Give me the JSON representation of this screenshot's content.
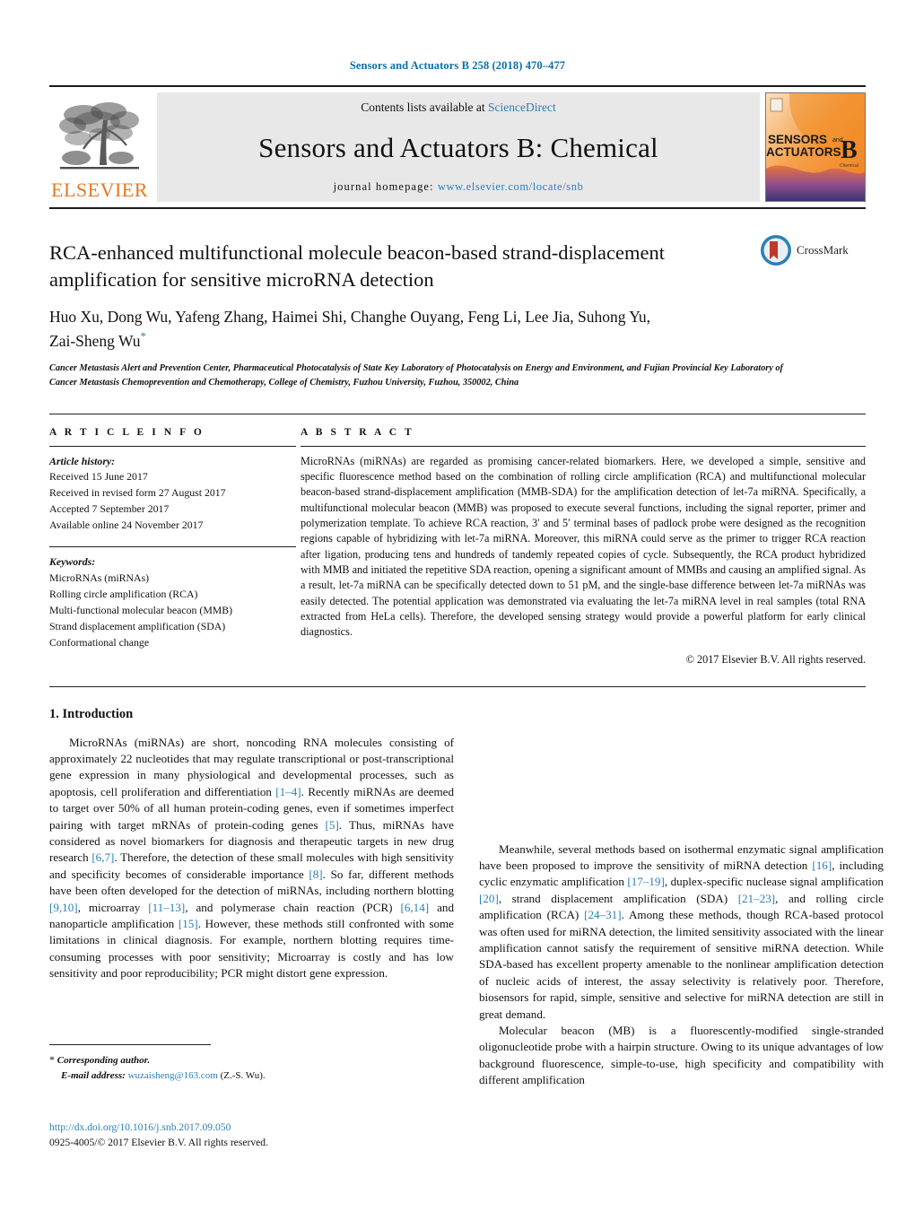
{
  "running_head": "Sensors and Actuators B 258 (2018) 470–477",
  "masthead": {
    "publisher_logo_word": "ELSEVIER",
    "contents_prefix": "Contents lists available at ",
    "contents_link": "ScienceDirect",
    "journal_title": "Sensors and Actuators B: Chemical",
    "homepage_prefix": "journal homepage: ",
    "homepage_url": "www.elsevier.com/locate/snb",
    "cover": {
      "line1": "SENSORS",
      "line1_suffix": "and",
      "line2": "ACTUATORS",
      "letter": "B",
      "letter_sub": "Chemical"
    }
  },
  "crossmark": {
    "label": "CrossMark"
  },
  "article": {
    "title": "RCA-enhanced multifunctional molecule beacon-based strand-displacement amplification for sensitive microRNA detection",
    "authors": "Huo Xu, Dong Wu, Yafeng Zhang, Haimei Shi, Changhe Ouyang, Feng Li, Lee Jia, Suhong Yu, Zai-Sheng Wu",
    "corresponding_marker": "*",
    "affiliation": "Cancer Metastasis Alert and Prevention Center, Pharmaceutical Photocatalysis of State Key Laboratory of Photocatalysis on Energy and Environment, and Fujian Provincial Key Laboratory of Cancer Metastasis Chemoprevention and Chemotherapy, College of Chemistry, Fuzhou University, Fuzhou, 350002, China"
  },
  "article_info": {
    "heading": "A R T I C L E   I N F O",
    "history_label": "Article history:",
    "history": [
      "Received 15 June 2017",
      "Received in revised form 27 August 2017",
      "Accepted 7 September 2017",
      "Available online 24 November 2017"
    ],
    "keywords_label": "Keywords:",
    "keywords": [
      "MicroRNAs (miRNAs)",
      "Rolling circle amplification (RCA)",
      "Multi-functional molecular beacon (MMB)",
      "Strand displacement amplification (SDA)",
      "Conformational change"
    ]
  },
  "abstract": {
    "heading": "A B S T R A C T",
    "text": "MicroRNAs (miRNAs) are regarded as promising cancer-related biomarkers. Here, we developed a simple, sensitive and specific fluorescence method based on the combination of rolling circle amplification (RCA) and multifunctional molecular beacon-based strand-displacement amplification (MMB-SDA) for the amplification detection of let-7a miRNA. Specifically, a multifunctional molecular beacon (MMB) was proposed to execute several functions, including the signal reporter, primer and polymerization template. To achieve RCA reaction, 3′ and 5′ terminal bases of padlock probe were designed as the recognition regions capable of hybridizing with let-7a miRNA. Moreover, this miRNA could serve as the primer to trigger RCA reaction after ligation, producing tens and hundreds of tandemly repeated copies of cycle. Subsequently, the RCA product hybridized with MMB and initiated the repetitive SDA reaction, opening a significant amount of MMBs and causing an amplified signal. As a result, let-7a miRNA can be specifically detected down to 51 pM, and the single-base difference between let-7a miRNAs was easily detected. The potential application was demonstrated via evaluating the let-7a miRNA level in real samples (total RNA extracted from HeLa cells). Therefore, the developed sensing strategy would provide a powerful platform for early clinical diagnostics.",
    "copyright": "© 2017 Elsevier B.V. All rights reserved."
  },
  "introduction": {
    "heading": "1.  Introduction",
    "left_paragraph_1_parts": [
      {
        "t": "MicroRNAs (miRNAs) are short, noncoding RNA molecules consisting of approximately 22 nucleotides that may regulate transcriptional or post-transcriptional gene expression in many physiological and developmental processes, such as apoptosis, cell proliferation and differentiation "
      },
      {
        "t": "[1–4]",
        "ref": true
      },
      {
        "t": ". Recently miRNAs are deemed to target over 50% of all human protein-coding genes, even if sometimes imperfect pairing with target mRNAs of protein-coding genes "
      },
      {
        "t": "[5]",
        "ref": true
      },
      {
        "t": ". Thus, miRNAs have considered as novel biomarkers for diagnosis and therapeutic targets in new drug research "
      },
      {
        "t": "[6,7]",
        "ref": true
      },
      {
        "t": ". Therefore, the detection of these small molecules with high sensitivity and specificity becomes of considerable importance "
      },
      {
        "t": "[8]",
        "ref": true
      },
      {
        "t": ". So far, different methods have been often developed for the detection of miRNAs, including northern blotting "
      },
      {
        "t": "[9,10]",
        "ref": true
      },
      {
        "t": ", microarray "
      },
      {
        "t": "[11–13]",
        "ref": true
      },
      {
        "t": ", and polymerase chain reaction (PCR) "
      },
      {
        "t": "[6,14]",
        "ref": true
      },
      {
        "t": " and nanoparticle amplification "
      },
      {
        "t": "[15]",
        "ref": true
      },
      {
        "t": ". However, these methods still confronted with some limitations in clinical diagnosis. For example, northern blotting requires time-consuming processes with poor sensitivity; Microarray is costly and has low sensitivity and poor reproducibility; PCR might distort gene expression."
      }
    ],
    "right_paragraph_2_parts": [
      {
        "t": "Meanwhile, several methods based on isothermal enzymatic signal amplification have been proposed to improve the sensitivity of miRNA detection "
      },
      {
        "t": "[16]",
        "ref": true
      },
      {
        "t": ", including cyclic enzymatic amplification "
      },
      {
        "t": "[17–19]",
        "ref": true
      },
      {
        "t": ", duplex-specific nuclease signal amplification "
      },
      {
        "t": "[20]",
        "ref": true
      },
      {
        "t": ", strand displacement amplification (SDA) "
      },
      {
        "t": "[21–23]",
        "ref": true
      },
      {
        "t": ", and rolling circle amplification (RCA) "
      },
      {
        "t": "[24–31]",
        "ref": true
      },
      {
        "t": ". Among these methods, though RCA-based protocol was often used for miRNA detection, the limited sensitivity associated with the linear amplification cannot satisfy the requirement of sensitive miRNA detection. While SDA-based has excellent property amenable to the nonlinear amplification detection of nucleic acids of interest, the assay selectivity is relatively poor. Therefore, biosensors for rapid, simple, sensitive and selective for miRNA detection are still in great demand."
      }
    ],
    "right_paragraph_3_parts": [
      {
        "t": "Molecular beacon (MB) is a fluorescently-modified single-stranded oligonucleotide probe with a hairpin structure. Owing to its unique advantages of low background fluorescence, simple-to-use, high specificity and compatibility with different amplification"
      }
    ]
  },
  "footnotes": {
    "corresponding_star": "*",
    "corresponding_label": "Corresponding author.",
    "email_label": "E-mail address:",
    "email": "wuzaisheng@163.com",
    "email_suffix": "(Z.-S. Wu)."
  },
  "imprint": {
    "doi": "http://dx.doi.org/10.1016/j.snb.2017.09.050",
    "issn_line": "0925-4005/© 2017 Elsevier B.V. All rights reserved."
  },
  "colors": {
    "link": "#2b7fb8",
    "running_head": "#0b6ea8",
    "elsevier_orange": "#e87722",
    "crossmark_red": "#c0392b",
    "crossmark_blue": "#2b7fb8"
  }
}
